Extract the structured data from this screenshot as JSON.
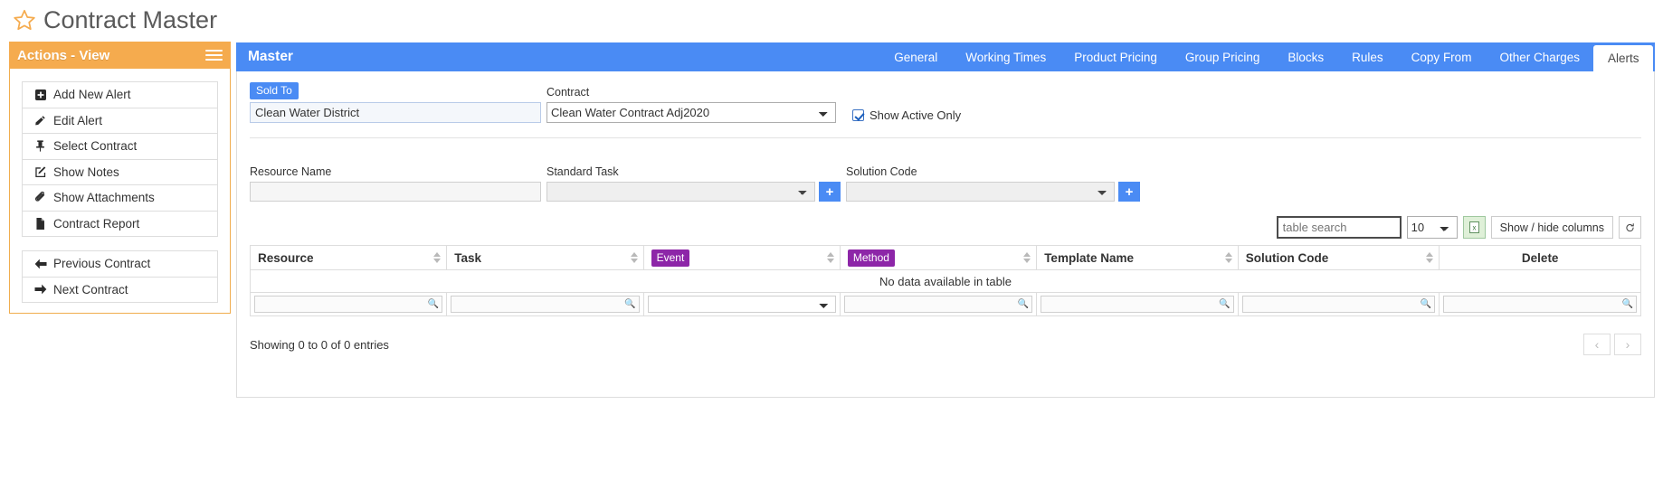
{
  "page": {
    "title": "Contract Master",
    "star_icon": "star-outline-icon"
  },
  "sidebar": {
    "header": "Actions - View",
    "menu_icon": "hamburger-icon",
    "groups": [
      {
        "items": [
          {
            "label": "Add New Alert",
            "icon": "plus-square-icon"
          },
          {
            "label": "Edit Alert",
            "icon": "pencil-icon"
          },
          {
            "label": "Select Contract",
            "icon": "pin-icon"
          },
          {
            "label": "Show Notes",
            "icon": "edit-note-icon"
          },
          {
            "label": "Show Attachments",
            "icon": "paperclip-icon"
          },
          {
            "label": "Contract Report",
            "icon": "file-icon"
          }
        ]
      },
      {
        "items": [
          {
            "label": "Previous Contract",
            "icon": "arrow-left-icon"
          },
          {
            "label": "Next Contract",
            "icon": "arrow-right-icon"
          }
        ]
      }
    ]
  },
  "panel": {
    "title": "Master",
    "tabs": [
      {
        "label": "General",
        "active": false
      },
      {
        "label": "Working Times",
        "active": false
      },
      {
        "label": "Product Pricing",
        "active": false
      },
      {
        "label": "Group Pricing",
        "active": false
      },
      {
        "label": "Blocks",
        "active": false
      },
      {
        "label": "Rules",
        "active": false
      },
      {
        "label": "Copy From",
        "active": false
      },
      {
        "label": "Other Charges",
        "active": false
      },
      {
        "label": "Alerts",
        "active": true
      }
    ]
  },
  "form": {
    "sold_to_label": "Sold To",
    "sold_to_value": "Clean Water District",
    "sold_to_placeholder": "",
    "contract_label": "Contract",
    "contract_value": "Clean Water Contract Adj2020",
    "show_active_only_label": "Show Active Only",
    "show_active_only_checked": true
  },
  "filters": {
    "resource_name_label": "Resource Name",
    "resource_name_value": "",
    "standard_task_label": "Standard Task",
    "standard_task_value": "",
    "standard_task_add": "+",
    "solution_code_label": "Solution Code",
    "solution_code_value": "",
    "solution_code_add": "+"
  },
  "toolbar": {
    "search_placeholder": "table search",
    "search_value": "",
    "page_length": "10",
    "excel_icon": "excel-export-icon",
    "columns_label": "Show / hide columns",
    "refresh_icon": "refresh-icon"
  },
  "table": {
    "columns": [
      {
        "label": "Resource",
        "badge": false,
        "sortable": true,
        "align": "left"
      },
      {
        "label": "Task",
        "badge": false,
        "sortable": true,
        "align": "left"
      },
      {
        "label": "Event",
        "badge": true,
        "sortable": true,
        "align": "left"
      },
      {
        "label": "Method",
        "badge": true,
        "sortable": true,
        "align": "left"
      },
      {
        "label": "Template Name",
        "badge": false,
        "sortable": true,
        "align": "left"
      },
      {
        "label": "Solution Code",
        "badge": false,
        "sortable": true,
        "align": "left"
      },
      {
        "label": "Delete",
        "badge": false,
        "sortable": false,
        "align": "center"
      }
    ],
    "empty_message": "No data available in table",
    "column_filters": [
      {
        "type": "text",
        "value": "",
        "icon": "search-icon"
      },
      {
        "type": "text",
        "value": "",
        "icon": "search-icon"
      },
      {
        "type": "select",
        "value": "",
        "icon": "chevron-down-icon"
      },
      {
        "type": "text",
        "value": "",
        "icon": "search-icon"
      },
      {
        "type": "text",
        "value": "",
        "icon": "search-icon"
      },
      {
        "type": "text",
        "value": "",
        "icon": "search-icon"
      },
      {
        "type": "text",
        "value": "",
        "icon": "search-icon"
      }
    ],
    "rows": []
  },
  "footer": {
    "info": "Showing 0 to 0 of 0 entries",
    "prev_label": "‹",
    "next_label": "›"
  },
  "colors": {
    "accent_blue": "#4a8bf4",
    "accent_orange": "#f5ab4e",
    "badge_purple": "#8d26a8",
    "excel_green": "#dff0d8"
  }
}
